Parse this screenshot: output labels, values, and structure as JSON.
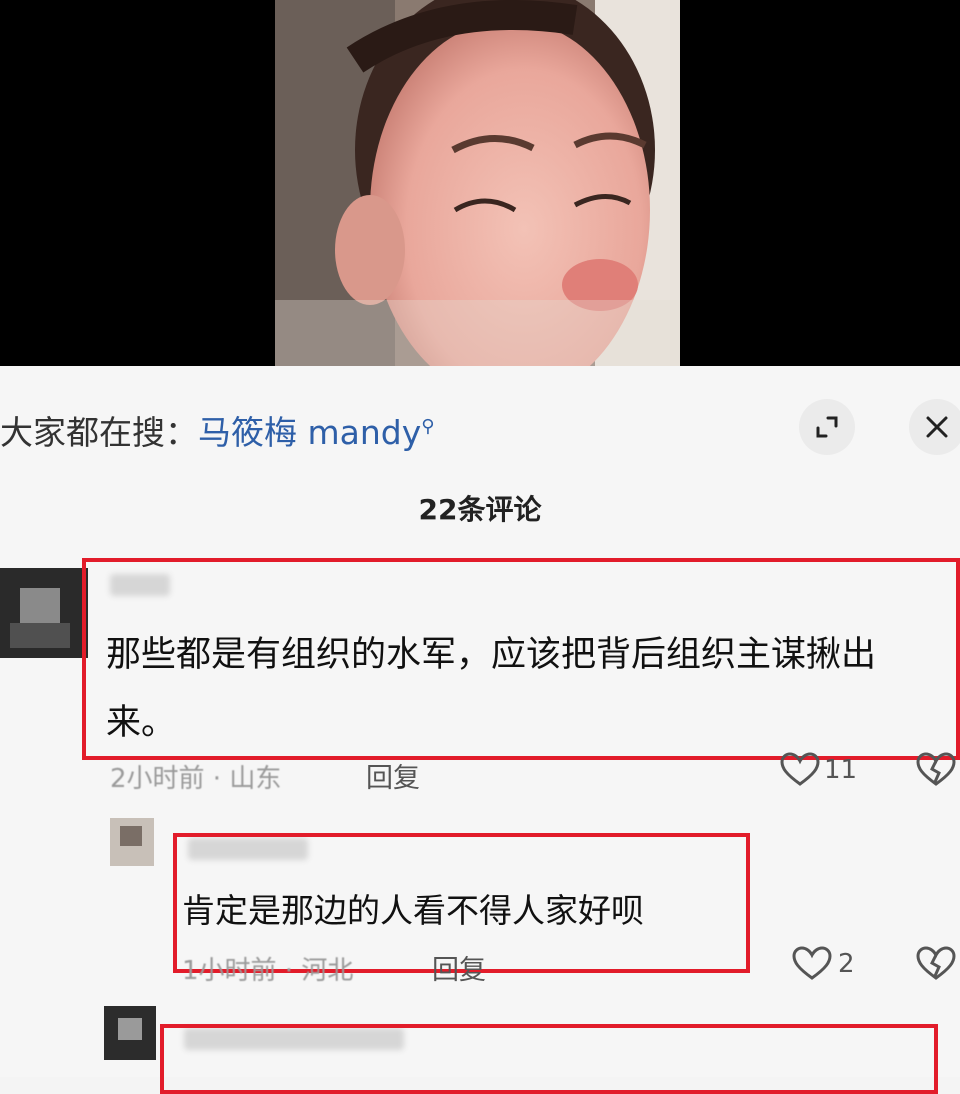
{
  "search": {
    "prefix": "大家都在搜：",
    "term": "马筱梅 mandy",
    "icon": "search-icon"
  },
  "header": {
    "comment_count": "22条评论",
    "expand_icon": "expand-icon",
    "close_icon": "close-icon"
  },
  "comments": [
    {
      "text_line1": "那些都是有组织的水军，应该把背后组织主谋揪出",
      "text_line2": "来。",
      "meta": "2小时前 · 山东",
      "reply": "回复",
      "likes": "11"
    },
    {
      "text": "肯定是那边的人看不得人家好呗",
      "meta": "1小时前 · 河北",
      "reply": "回复",
      "likes": "2"
    }
  ],
  "colors": {
    "highlight": "#e21c2a",
    "search_term": "#2e5fa8"
  }
}
